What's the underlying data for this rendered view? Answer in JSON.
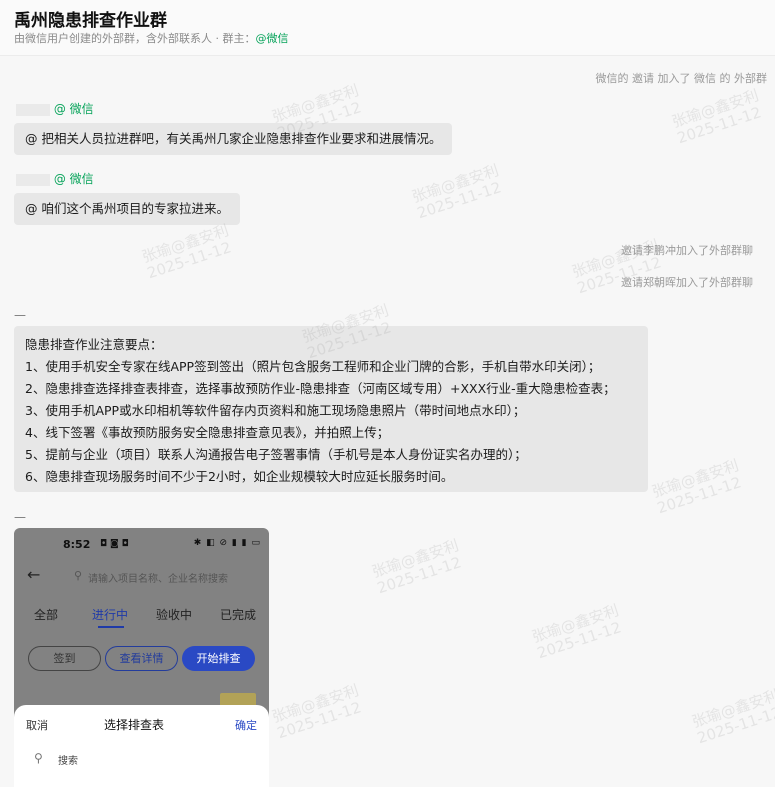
{
  "header": {
    "title": "禹州隐患排查作业群",
    "subtitle": "由微信用户创建的外部群，含外部联系人 · 群主：",
    "subtitle_wechat": "@微信"
  },
  "system_top": "微信的 邀请 加入了 微信 的 外部群",
  "messages": [
    {
      "sender_suffix": "@ 微信",
      "text": "@        把相关人员拉进群吧，有关禹州几家企业隐患排查作业要求和进展情况。"
    },
    {
      "sender_suffix": "@ 微信",
      "text": "@      咱们这个禹州项目的专家拉进来。"
    }
  ],
  "system_join": [
    "邀请李鹏冲加入了外部群聊",
    "邀请郑朝晖加入了外部群聊"
  ],
  "dash_1": "—",
  "dash_2": "—",
  "notice": {
    "lines": [
      "隐患排查作业注意要点：",
      "1、使用手机安全专家在线APP签到签出（照片包含服务工程师和企业门牌的合影，手机自带水印关闭）；",
      "2、隐患排查选择排查表排查，选择事故预防作业-隐患排查（河南区域专用）+XXX行业-重大隐患检查表；",
      "3、使用手机APP或水印相机等软件留存内页资料和施工现场隐患照片（带时间地点水印）；",
      "4、线下签署《事故预防服务安全隐患排查意见表》，并拍照上传；",
      "5、提前与企业（项目）联系人沟通报告电子签署事情（手机号是本人身份证实名办理的）；",
      "6、隐患排查现场服务时间不少于2小时，如企业规模较大时应延长服务时间。"
    ]
  },
  "phone": {
    "time": "8:52",
    "status_dots": "◘ ◙ ◘",
    "status_right": "✱ ◧ ⊘ ▮ ▮ ▭",
    "search_placeholder": "请输入项目名称、企业名称搜索",
    "tabs": [
      "全部",
      "进行中",
      "验收中",
      "已完成"
    ],
    "buttons": [
      "签到",
      "查看详情",
      "开始排查"
    ],
    "sheet": {
      "cancel": "取消",
      "title": "选择排查表",
      "confirm": "确定",
      "search": "搜索"
    }
  },
  "watermark": {
    "name": "张瑜@鑫安利",
    "date": "2025-11-12"
  },
  "colors": {
    "wechat_green": "#07a35a",
    "bubble_bg": "#e7e7e7",
    "phone_accent": "#2a49c4"
  }
}
